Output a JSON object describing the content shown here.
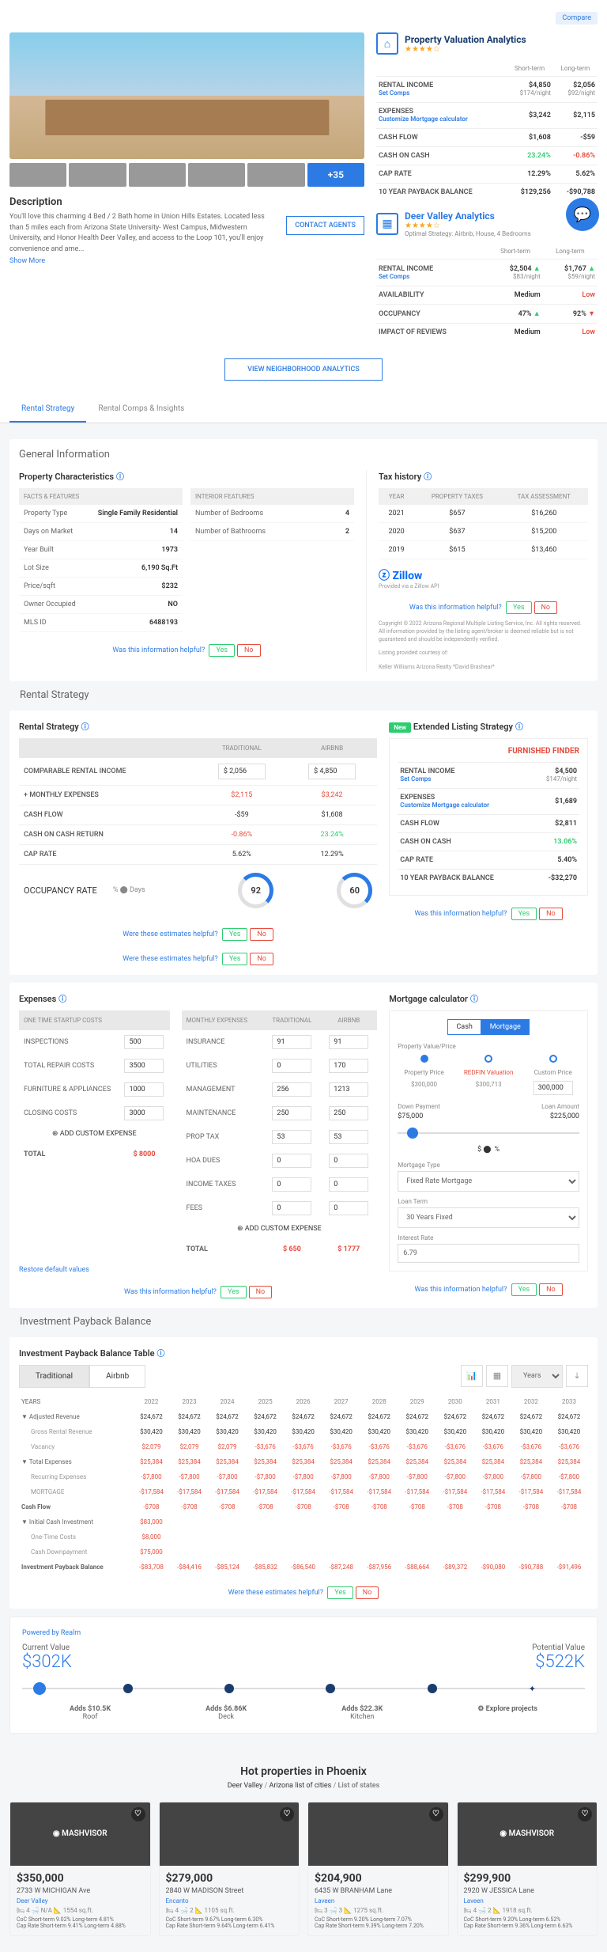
{
  "compare": "Compare",
  "more_photos": "+35",
  "description": {
    "title": "Description",
    "text": "You'll love this charming 4 Bed / 2 Bath home in Union Hills Estates. Located less than 5 miles each from Arizona State University- West Campus, Midwestern University, and Honor Health Deer Valley, and access to the Loop 101, you'll enjoy convenience and ame...",
    "show_more": "Show More",
    "contact": "CONTACT AGENTS"
  },
  "valuation": {
    "title": "Property Valuation Analytics",
    "stars": "★★★★☆",
    "cols": [
      "Short-term",
      "Long-term"
    ],
    "rows": [
      {
        "label": "RENTAL INCOME",
        "sub": "Set Comps",
        "v1": "$4,850",
        "s1": "$174/night",
        "v2": "$2,056",
        "s2": "$92/night"
      },
      {
        "label": "EXPENSES",
        "sub": "Customize  Mortgage calculator",
        "v1": "$3,242",
        "v2": "$2,115"
      },
      {
        "label": "CASH FLOW",
        "v1": "$1,608",
        "v2": "-$59"
      },
      {
        "label": "CASH ON CASH",
        "v1": "23.24%",
        "c1": "green",
        "v2": "-0.86%",
        "c2": "red"
      },
      {
        "label": "CAP RATE",
        "v1": "12.29%",
        "v2": "5.62%"
      },
      {
        "label": "10 YEAR PAYBACK BALANCE",
        "v1": "$129,256",
        "v2": "-$90,788"
      }
    ]
  },
  "neighborhood": {
    "title": "Deer Valley Analytics",
    "stars": "★★★★☆",
    "sub": "Optimal Strategy: Airbnb, House, 4 Bedrooms",
    "cols": [
      "Short-term",
      "Long-term"
    ],
    "rows": [
      {
        "label": "RENTAL INCOME",
        "sub": "Set Comps",
        "v1": "$2,504",
        "s1": "$83/night",
        "a1": "▲",
        "v2": "$1,767",
        "s2": "$59/night",
        "a2": "▲"
      },
      {
        "label": "AVAILABILITY",
        "v1": "Medium",
        "v2": "Low",
        "c2": "red"
      },
      {
        "label": "OCCUPANCY",
        "v1": "47%",
        "a1": "▲",
        "v2": "92%",
        "a2": "▼",
        "c2a": "red"
      },
      {
        "label": "IMPACT OF REVIEWS",
        "v1": "Medium",
        "v2": "Low",
        "c2": "red"
      }
    ]
  },
  "neighbor_btn": "VIEW NEIGHBORHOOD ANALYTICS",
  "tabs": [
    "Rental Strategy",
    "Rental Comps & Insights"
  ],
  "gen_info": {
    "title": "General Information",
    "chars_title": "Property Characteristics",
    "facts_head": "FACTS & FEATURES",
    "interior_head": "INTERIOR FEATURES",
    "facts": [
      {
        "l": "Property Type",
        "v": "Single Family Residential"
      },
      {
        "l": "Days on Market",
        "v": "14"
      },
      {
        "l": "Year Built",
        "v": "1973"
      },
      {
        "l": "Lot Size",
        "v": "6,190 Sq.Ft"
      },
      {
        "l": "Price/sqft",
        "v": "$232"
      },
      {
        "l": "Owner Occupied",
        "v": "NO"
      },
      {
        "l": "MLS ID",
        "v": "6488193"
      }
    ],
    "interior": [
      {
        "l": "Number of Bedrooms",
        "v": "4"
      },
      {
        "l": "Number of Bathrooms",
        "v": "2"
      }
    ],
    "tax_title": "Tax history",
    "tax_cols": [
      "YEAR",
      "PROPERTY TAXES",
      "TAX ASSESSMENT"
    ],
    "tax_rows": [
      [
        "2021",
        "$657",
        "$16,260"
      ],
      [
        "2020",
        "$637",
        "$15,200"
      ],
      [
        "2019",
        "$615",
        "$13,460"
      ]
    ],
    "zillow": "Zillow",
    "zillow_sub": "Provided via a Zillow API",
    "disclaimer": "Copyright © 2022 Arizona Regional Multiple Listing Service, Inc. All rights reserved. All information provided by the listing agent/broker is deemed reliable but is not guaranteed and should be independently verified.",
    "courtesy": "Listing provided courtesy of:",
    "broker": "Keller Williams Arizona Realty *David Brashear*"
  },
  "helpful_q": "Was this information helpful?",
  "helpful_est": "Were these estimates helpful?",
  "yes": "Yes",
  "no": "No",
  "rental_strategy": {
    "section_title": "Rental Strategy",
    "title": "Rental Strategy",
    "cols": [
      "TRADITIONAL",
      "AIRBNB"
    ],
    "rows": [
      {
        "l": "COMPARABLE RENTAL INCOME",
        "v1": "2,056",
        "v2": "4,850",
        "input": true
      },
      {
        "l": "+ MONTHLY EXPENSES",
        "v1": "$2,115",
        "c1": "red",
        "v2": "$3,242",
        "c2": "red"
      },
      {
        "l": "CASH FLOW",
        "v1": "-$59",
        "v2": "$1,608"
      },
      {
        "l": "CASH ON CASH RETURN",
        "v1": "-0.86%",
        "c1": "red",
        "v2": "23.24%",
        "c2": "green"
      },
      {
        "l": "CAP RATE",
        "v1": "5.62%",
        "v2": "12.29%"
      }
    ],
    "occ_label": "OCCUPANCY RATE",
    "occ_toggle": "Days",
    "occ_v1": "92",
    "occ_v2": "60"
  },
  "extended": {
    "new": "New",
    "title": "Extended Listing Strategy",
    "brand": "FURNISHED FINDER",
    "rows": [
      {
        "l": "RENTAL INCOME",
        "sub": "Set Comps",
        "v": "$4,500",
        "s": "$147/night"
      },
      {
        "l": "EXPENSES",
        "sub": "Customize  Mortgage calculator",
        "v": "$1,689"
      },
      {
        "l": "CASH FLOW",
        "v": "$2,811"
      },
      {
        "l": "CASH ON CASH",
        "v": "13.06%",
        "c": "green"
      },
      {
        "l": "CAP RATE",
        "v": "5.40%"
      },
      {
        "l": "10 YEAR PAYBACK BALANCE",
        "v": "-$32,270"
      }
    ]
  },
  "expenses": {
    "title": "Expenses",
    "startup_head": "ONE TIME STARTUP COSTS",
    "monthly_head": "MONTHLY EXPENSES",
    "trad_head": "TRADITIONAL",
    "airbnb_head": "AIRBNB",
    "startup": [
      {
        "l": "INSPECTIONS",
        "v": "500"
      },
      {
        "l": "TOTAL REPAIR COSTS",
        "v": "3500"
      },
      {
        "l": "FURNITURE & APPLIANCES",
        "v": "1000"
      },
      {
        "l": "CLOSING COSTS",
        "v": "3000"
      }
    ],
    "monthly": [
      {
        "l": "INSURANCE",
        "v1": "91",
        "v2": "91"
      },
      {
        "l": "UTILITIES",
        "v1": "0",
        "v2": "170"
      },
      {
        "l": "MANAGEMENT",
        "v1": "256",
        "v2": "1213"
      },
      {
        "l": "MAINTENANCE",
        "v1": "250",
        "v2": "250"
      },
      {
        "l": "PROP TAX",
        "v1": "53",
        "v2": "53"
      },
      {
        "l": "HOA DUES",
        "v1": "0",
        "v2": "0"
      },
      {
        "l": "INCOME TAXES",
        "v1": "0",
        "v2": "0"
      },
      {
        "l": "FEES",
        "v1": "0",
        "v2": "0"
      }
    ],
    "add": "ADD CUSTOM EXPENSE",
    "total": "TOTAL",
    "startup_total": "$ 8000",
    "monthly_t1": "$ 650",
    "monthly_t2": "$ 1777",
    "restore": "Restore default values"
  },
  "calculator": {
    "title": "Mortgage calculator",
    "modes": [
      "Cash",
      "Mortgage"
    ],
    "pv_label": "Property Value/Price",
    "opts": [
      "Property Price",
      "REDFIN Valuation",
      "Custom Price"
    ],
    "vals": [
      "$300,000",
      "$300,713",
      "300,000"
    ],
    "dp_label": "Down Payment",
    "la_label": "Loan Amount",
    "dp": "$75,000",
    "la": "$225,000",
    "pct": "%",
    "mt_label": "Mortgage Type",
    "mt": "Fixed Rate Mortgage",
    "lt_label": "Loan Term",
    "lt": "30 Years Fixed",
    "ir_label": "Interest Rate",
    "ir": "6.79"
  },
  "payback": {
    "section_title": "Investment Payback Balance",
    "title": "Investment Payback Balance Table",
    "tabs": [
      "Traditional",
      "Airbnb"
    ],
    "icons": [
      "chart",
      "table"
    ],
    "select": "Years",
    "years": [
      "2022",
      "2023",
      "2024",
      "2025",
      "2026",
      "2027",
      "2028",
      "2029",
      "2030",
      "2031",
      "2032",
      "2033"
    ],
    "rows": [
      {
        "l": "▼ Adjusted Revenue",
        "vals": [
          "$24,672",
          "$24,672",
          "$24,672",
          "$24,672",
          "$24,672",
          "$24,672",
          "$24,672",
          "$24,672",
          "$24,672",
          "$24,672",
          "$24,672",
          "$24,672"
        ]
      },
      {
        "l": "Gross Rental Revenue",
        "sub": true,
        "vals": [
          "$30,420",
          "$30,420",
          "$30,420",
          "$30,420",
          "$30,420",
          "$30,420",
          "$30,420",
          "$30,420",
          "$30,420",
          "$30,420",
          "$30,420",
          "$30,420"
        ]
      },
      {
        "l": "Vacancy",
        "sub": true,
        "c": "red",
        "vals": [
          "$2,079",
          "$2,079",
          "$2,079",
          "-$3,676",
          "-$3,676",
          "-$3,676",
          "-$3,676",
          "-$3,676",
          "-$3,676",
          "-$3,676",
          "-$3,676",
          "-$3,676"
        ]
      },
      {
        "l": "▼ Total Expenses",
        "c": "red",
        "vals": [
          "$25,384",
          "$25,384",
          "$25,384",
          "$25,384",
          "$25,384",
          "$25,384",
          "$25,384",
          "$25,384",
          "$25,384",
          "$25,384",
          "$25,384",
          "$25,384"
        ]
      },
      {
        "l": "Recurring Expenses",
        "sub": true,
        "c": "red",
        "vals": [
          "-$7,800",
          "-$7,800",
          "-$7,800",
          "-$7,800",
          "-$7,800",
          "-$7,800",
          "-$7,800",
          "-$7,800",
          "-$7,800",
          "-$7,800",
          "-$7,800",
          "-$7,800"
        ]
      },
      {
        "l": "MORTGAGE",
        "sub": true,
        "c": "red",
        "vals": [
          "-$17,584",
          "-$17,584",
          "-$17,584",
          "-$17,584",
          "-$17,584",
          "-$17,584",
          "-$17,584",
          "-$17,584",
          "-$17,584",
          "-$17,584",
          "-$17,584",
          "-$17,584"
        ]
      },
      {
        "l": "Cash Flow",
        "bold": true,
        "c": "red",
        "vals": [
          "-$708",
          "-$708",
          "-$708",
          "-$708",
          "-$708",
          "-$708",
          "-$708",
          "-$708",
          "-$708",
          "-$708",
          "-$708",
          "-$708"
        ]
      },
      {
        "l": "▼ Initial Cash Investment",
        "c": "red",
        "vals": [
          "$83,000",
          "",
          "",
          "",
          "",
          "",
          "",
          "",
          "",
          "",
          "",
          ""
        ]
      },
      {
        "l": "One-Time Costs",
        "sub": true,
        "c": "red",
        "vals": [
          "$8,000",
          "",
          "",
          "",
          "",
          "",
          "",
          "",
          "",
          "",
          "",
          ""
        ]
      },
      {
        "l": "Cash Downpayment",
        "sub": true,
        "c": "red",
        "vals": [
          "$75,000",
          "",
          "",
          "",
          "",
          "",
          "",
          "",
          "",
          "",
          "",
          ""
        ]
      },
      {
        "l": "Investment Payback Balance",
        "bold": true,
        "c": "red",
        "vals": [
          "-$83,708",
          "-$84,416",
          "-$85,124",
          "-$85,832",
          "-$86,540",
          "-$87,248",
          "-$87,956",
          "-$88,664",
          "-$89,372",
          "-$90,080",
          "-$90,788",
          "-$91,496"
        ]
      }
    ]
  },
  "realm": {
    "powered": "Powered by Realm",
    "current_label": "Current Value",
    "current": "$302K",
    "potential_label": "Potential Value",
    "potential": "$522K",
    "items": [
      {
        "title": "Adds $10.5K",
        "sub": "Roof"
      },
      {
        "title": "Adds $6.86K",
        "sub": "Deck"
      },
      {
        "title": "Adds $22.3K",
        "sub": "Kitchen"
      },
      {
        "title": "⚙ Explore projects",
        "sub": ""
      }
    ]
  },
  "hot": {
    "title": "Hot properties in Phoenix",
    "breadcrumb": [
      "Deer Valley",
      "Arizona list of cities",
      "List of states"
    ],
    "props": [
      {
        "brand": "◉ MASHVISOR",
        "price": "$350,000",
        "addr": "2733 W MICHIGAN Ave",
        "neigh": "Deer Valley",
        "beds": "4",
        "baths": "N/A",
        "sqft": "1554 sq.ft.",
        "coc": "CoC Short-term 9.02% Long-term 4.81%",
        "cap": "Cap Rate Short-term 9.41% Long-term 4.88%"
      },
      {
        "brand": "",
        "price": "$279,000",
        "addr": "2840 W MADISON Street",
        "neigh": "Encanto",
        "beds": "4",
        "baths": "2",
        "sqft": "1105 sq.ft.",
        "coc": "CoC Short-term 9.67% Long-term 6.30%",
        "cap": "Cap Rate Short-term 9.64% Long-term 6.41%"
      },
      {
        "brand": "",
        "price": "$204,900",
        "addr": "6435 W BRANHAM Lane",
        "neigh": "Laveen",
        "beds": "3",
        "baths": "3",
        "sqft": "1275 sq.ft.",
        "coc": "CoC Short-term 9.20% Long-term 7.07%",
        "cap": "Cap Rate Short-term 9.39% Long-term 7.20%"
      },
      {
        "brand": "◉ MASHVISOR",
        "price": "$299,900",
        "addr": "2920 W JESSICA Lane",
        "neigh": "Laveen",
        "beds": "4",
        "baths": "2",
        "sqft": "1918 sq.ft.",
        "coc": "CoC Short-term 9.20% Long-term 6.52%",
        "cap": "Cap Rate Short-term 9.36% Long-term 6.63%"
      }
    ]
  }
}
